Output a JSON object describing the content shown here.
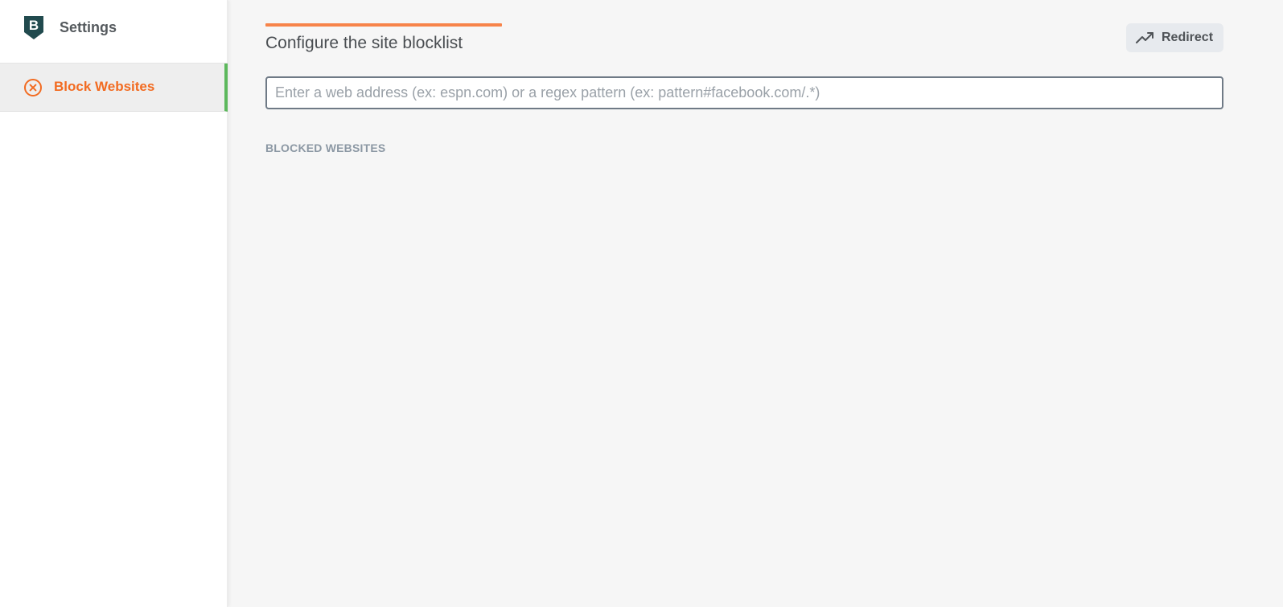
{
  "sidebar": {
    "title": "Settings",
    "logo_letter": "B",
    "logo_icon": "shield-b-logo",
    "items": [
      {
        "label": "Block Websites",
        "icon": "close-circle-icon",
        "active": true
      }
    ]
  },
  "main": {
    "title": "Configure the site blocklist",
    "redirect_button": {
      "label": "Redirect",
      "icon": "trending-up-icon"
    },
    "input": {
      "placeholder": "Enter a web address (ex: espn.com) or a regex pattern (ex: pattern#facebook.com/.*)",
      "value": ""
    },
    "section_label": "BLOCKED WEBSITES",
    "blocked_websites": []
  },
  "colors": {
    "accent_orange": "#f26b21",
    "title_underline": "#f7844a",
    "active_indicator": "#5cb85c",
    "logo_dark": "#214a4e"
  }
}
